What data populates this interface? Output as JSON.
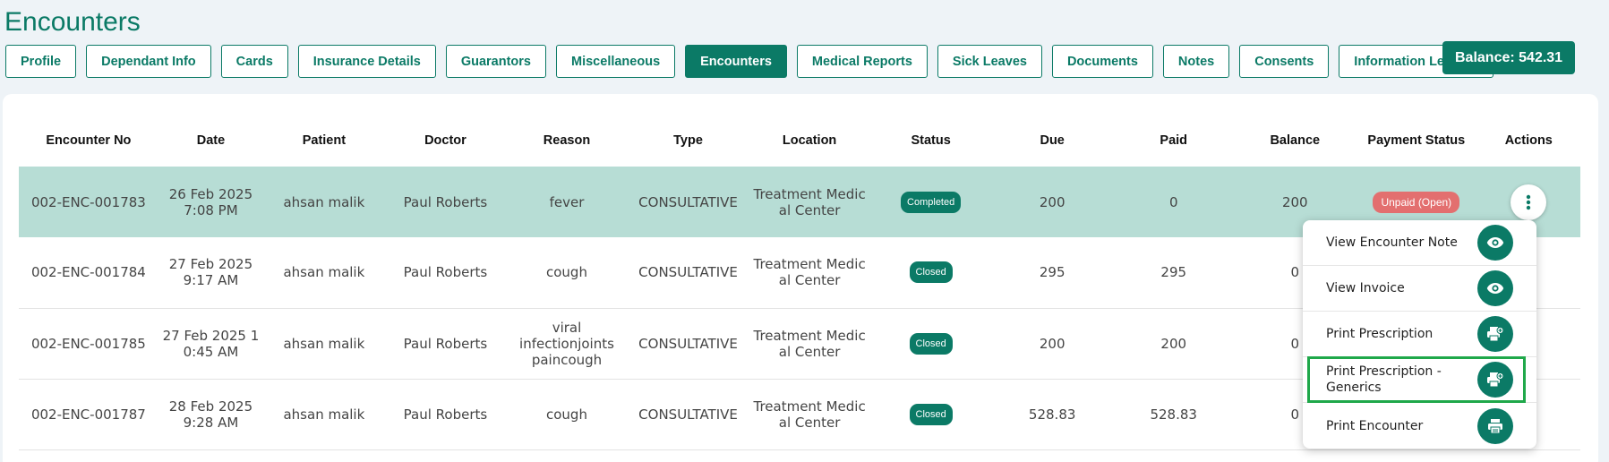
{
  "page": {
    "title": "Encounters"
  },
  "tabs": [
    {
      "label": "Profile",
      "active": false
    },
    {
      "label": "Dependant Info",
      "active": false
    },
    {
      "label": "Cards",
      "active": false
    },
    {
      "label": "Insurance Details",
      "active": false
    },
    {
      "label": "Guarantors",
      "active": false
    },
    {
      "label": "Miscellaneous",
      "active": false
    },
    {
      "label": "Encounters",
      "active": true
    },
    {
      "label": "Medical Reports",
      "active": false
    },
    {
      "label": "Sick Leaves",
      "active": false
    },
    {
      "label": "Documents",
      "active": false
    },
    {
      "label": "Notes",
      "active": false
    },
    {
      "label": "Consents",
      "active": false
    },
    {
      "label": "Information Leaflets",
      "active": false
    }
  ],
  "balance": {
    "label": "Balance: 542.31"
  },
  "table": {
    "headers": {
      "encounter_no": "Encounter No",
      "date": "Date",
      "patient": "Patient",
      "doctor": "Doctor",
      "reason": "Reason",
      "type": "Type",
      "location": "Location",
      "status": "Status",
      "due": "Due",
      "paid": "Paid",
      "balance": "Balance",
      "payment_status": "Payment Status",
      "actions": "Actions"
    },
    "rows": [
      {
        "encounter_no": "002-ENC-001783",
        "date": "26 Feb 2025 7:08 PM",
        "patient": "ahsan malik",
        "doctor": "Paul Roberts",
        "reason": "fever",
        "type": "CONSULTATIVE",
        "location": "Treatment Medical Center",
        "status": "Completed",
        "due": "200",
        "paid": "0",
        "balance": "200",
        "payment_status": "Unpaid (Open)",
        "selected": true
      },
      {
        "encounter_no": "002-ENC-001784",
        "date": "27 Feb 2025 9:17 AM",
        "patient": "ahsan malik",
        "doctor": "Paul Roberts",
        "reason": "cough",
        "type": "CONSULTATIVE",
        "location": "Treatment Medical Center",
        "status": "Closed",
        "due": "295",
        "paid": "295",
        "balance": "0",
        "payment_status": "",
        "selected": false
      },
      {
        "encounter_no": "002-ENC-001785",
        "date": "27 Feb 2025 10:45 AM",
        "patient": "ahsan malik",
        "doctor": "Paul Roberts",
        "reason": "viral infectionjoints paincough",
        "type": "CONSULTATIVE",
        "location": "Treatment Medical Center",
        "status": "Closed",
        "due": "200",
        "paid": "200",
        "balance": "0",
        "payment_status": "",
        "selected": false
      },
      {
        "encounter_no": "002-ENC-001787",
        "date": "28 Feb 2025 9:28 AM",
        "patient": "ahsan malik",
        "doctor": "Paul Roberts",
        "reason": "cough",
        "type": "CONSULTATIVE",
        "location": "Treatment Medical Center",
        "status": "Closed",
        "due": "528.83",
        "paid": "528.83",
        "balance": "0",
        "payment_status": "",
        "selected": false
      }
    ]
  },
  "actions_menu": {
    "items": [
      {
        "label": "View Encounter Note",
        "icon": "eye-icon"
      },
      {
        "label": "View Invoice",
        "icon": "eye-icon"
      },
      {
        "label": "Print Prescription",
        "icon": "print-prescription-icon"
      },
      {
        "label": "Print Prescription - Generics",
        "icon": "print-prescription-icon",
        "highlighted": true
      },
      {
        "label": "Print Encounter",
        "icon": "printer-icon"
      }
    ]
  },
  "colors": {
    "accent": "#0b7a66",
    "selected_row": "#b7ddd5",
    "unpaid": "#e36f6f",
    "highlight": "#1fa84a"
  }
}
